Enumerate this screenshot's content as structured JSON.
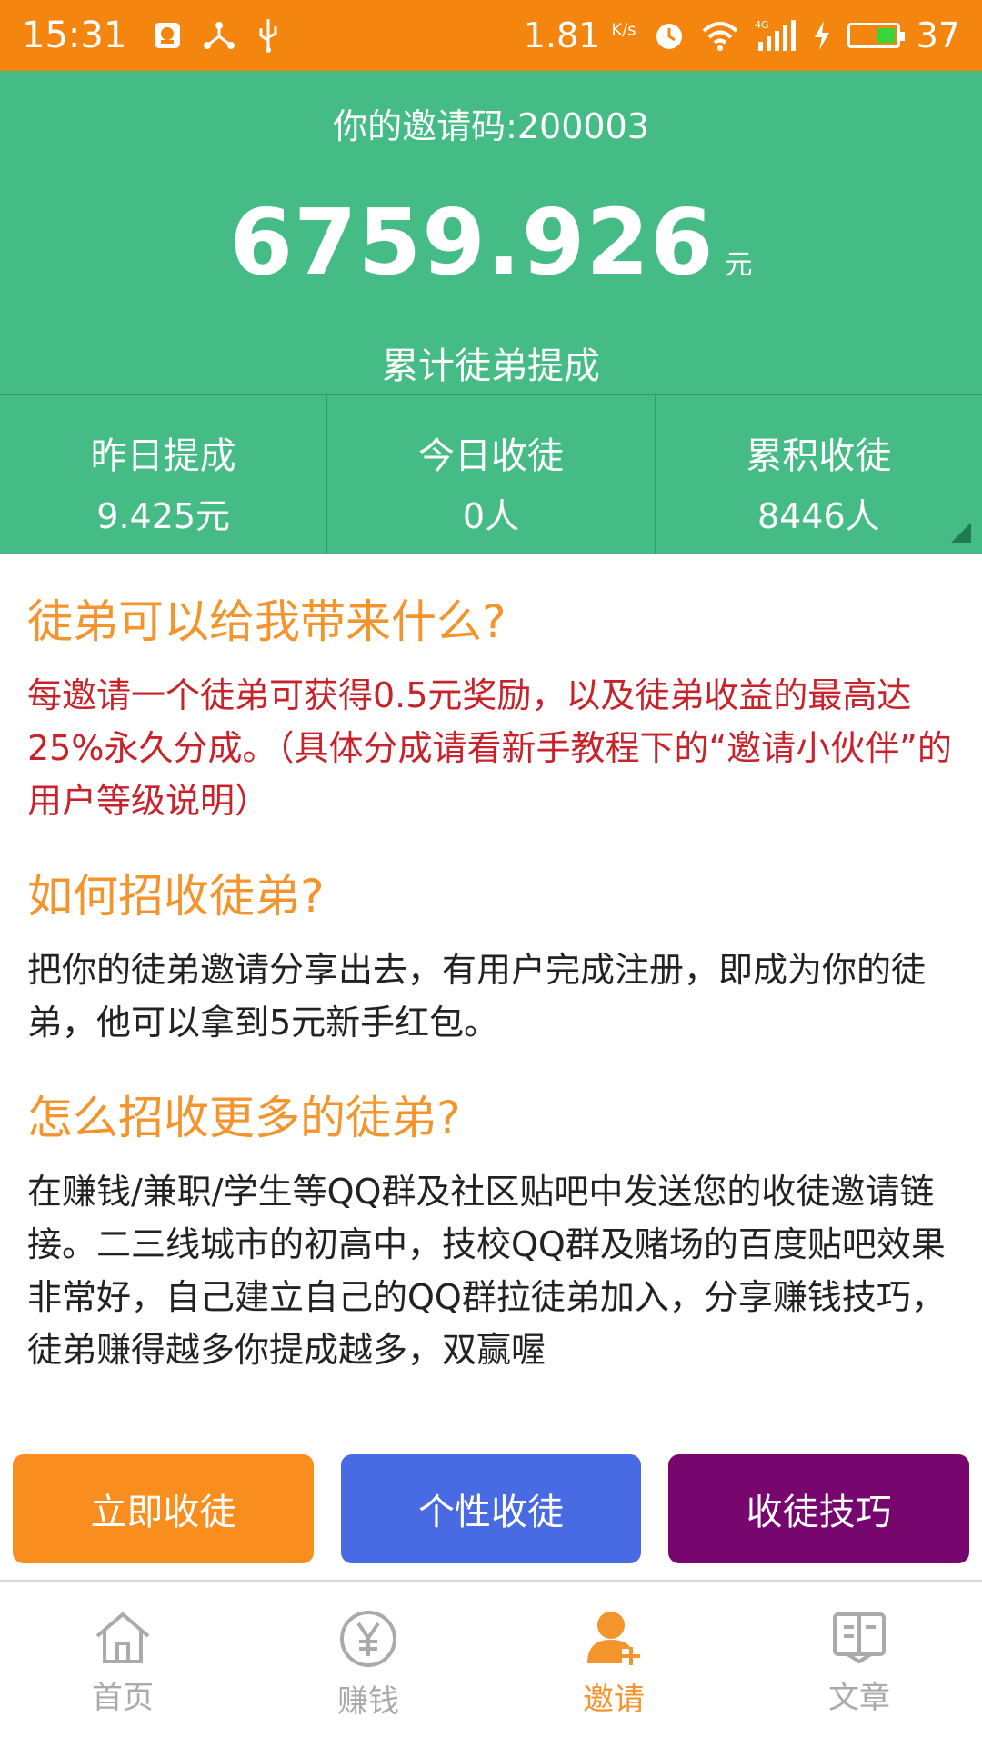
{
  "status_bar": {
    "time": "15:31",
    "net_speed": "1.81",
    "net_unit": "K/s",
    "battery": "37",
    "icons": [
      "notification-icon",
      "share-icon",
      "usb-icon",
      "alarm-icon",
      "wifi-icon",
      "signal-4g-icon",
      "charging-icon",
      "battery-icon"
    ]
  },
  "header": {
    "invite_code_line": "你的邀请码:200003",
    "total_amount": "6759.926",
    "unit": "元",
    "amount_label": "累计徒弟提成"
  },
  "stats": [
    {
      "title": "昨日提成",
      "value": "9.425元"
    },
    {
      "title": "今日收徒",
      "value": "0人"
    },
    {
      "title": "累积收徒",
      "value": "8446人"
    }
  ],
  "sections": {
    "s1_title": "徒弟可以给我带来什么?",
    "s1_body": "每邀请一个徒弟可获得0.5元奖励，以及徒弟收益的最高达25%永久分成。（具体分成请看新手教程下的“邀请小伙伴”的用户等级说明）",
    "s2_title": "如何招收徒弟?",
    "s2_body": "把你的徒弟邀请分享出去，有用户完成注册，即成为你的徒弟，他可以拿到5元新手红包。",
    "s3_title": "怎么招收更多的徒弟?",
    "s3_body": "在赚钱/兼职/学生等QQ群及社区贴吧中发送您的收徒邀请链接。二三线城市的初高中，技校QQ群及赌场的百度贴吧效果非常好，自己建立自己的QQ群拉徒弟加入，分享赚钱技巧，徒弟赚得越多你提成越多，双赢喔"
  },
  "buttons": {
    "recruit_now": "立即收徒",
    "custom_recruit": "个性收徒",
    "recruit_tips": "收徒技巧"
  },
  "tabs": [
    {
      "label": "首页",
      "icon": "home-icon"
    },
    {
      "label": "赚钱",
      "icon": "yen-icon"
    },
    {
      "label": "邀请",
      "icon": "invite-user-icon"
    },
    {
      "label": "文章",
      "icon": "book-icon"
    }
  ],
  "colors": {
    "status_bar": "#f4850f",
    "header_green": "#45bc86",
    "accent_orange": "#f4942c",
    "red_text": "#c8222a",
    "btn_orange": "#f98e1e",
    "btn_blue": "#486be3",
    "btn_purple": "#78066f"
  }
}
